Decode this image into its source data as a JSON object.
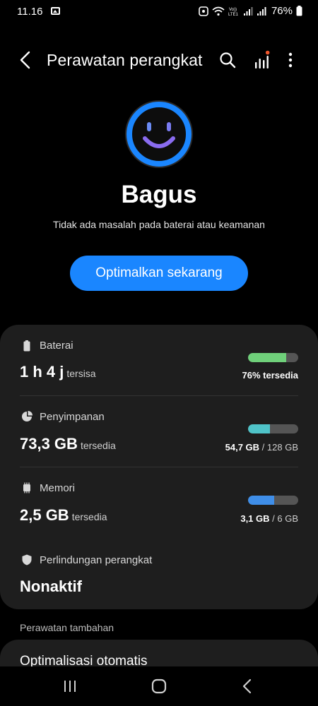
{
  "status_bar": {
    "time": "11.16",
    "battery_percent": "76%",
    "volte_label": "VoLTE"
  },
  "app_bar": {
    "title": "Perawatan perangkat"
  },
  "overview": {
    "status_heading": "Bagus",
    "status_description": "Tidak ada masalah pada baterai atau keamanan",
    "optimize_button": "Optimalkan sekarang"
  },
  "items": {
    "battery": {
      "label": "Baterai",
      "value": "1 h 4 j",
      "unit": "tersisa",
      "detail": "76% tersedia",
      "fill_fraction": 0.76,
      "bar_color": "#6fd07a"
    },
    "storage": {
      "label": "Penyimpanan",
      "value": "73,3 GB",
      "unit": "tersedia",
      "detail_used": "54,7 GB",
      "detail_sep": " / ",
      "detail_total": "128 GB",
      "fill_fraction": 0.43,
      "bar_color": "#4fc3c8"
    },
    "memory": {
      "label": "Memori",
      "value": "2,5 GB",
      "unit": "tersedia",
      "detail_used": "3,1 GB",
      "detail_sep": " / ",
      "detail_total": "6 GB",
      "fill_fraction": 0.52,
      "bar_color": "#3f8ee8"
    },
    "protection": {
      "label": "Perlindungan perangkat",
      "value": "Nonaktif"
    }
  },
  "additional": {
    "section_label": "Perawatan tambahan",
    "auto_optimization": "Optimalisasi otomatis"
  },
  "colors": {
    "accent": "#1a86ff",
    "face_ring": "#1a86ff",
    "face_smile": "#8a6cf0"
  }
}
